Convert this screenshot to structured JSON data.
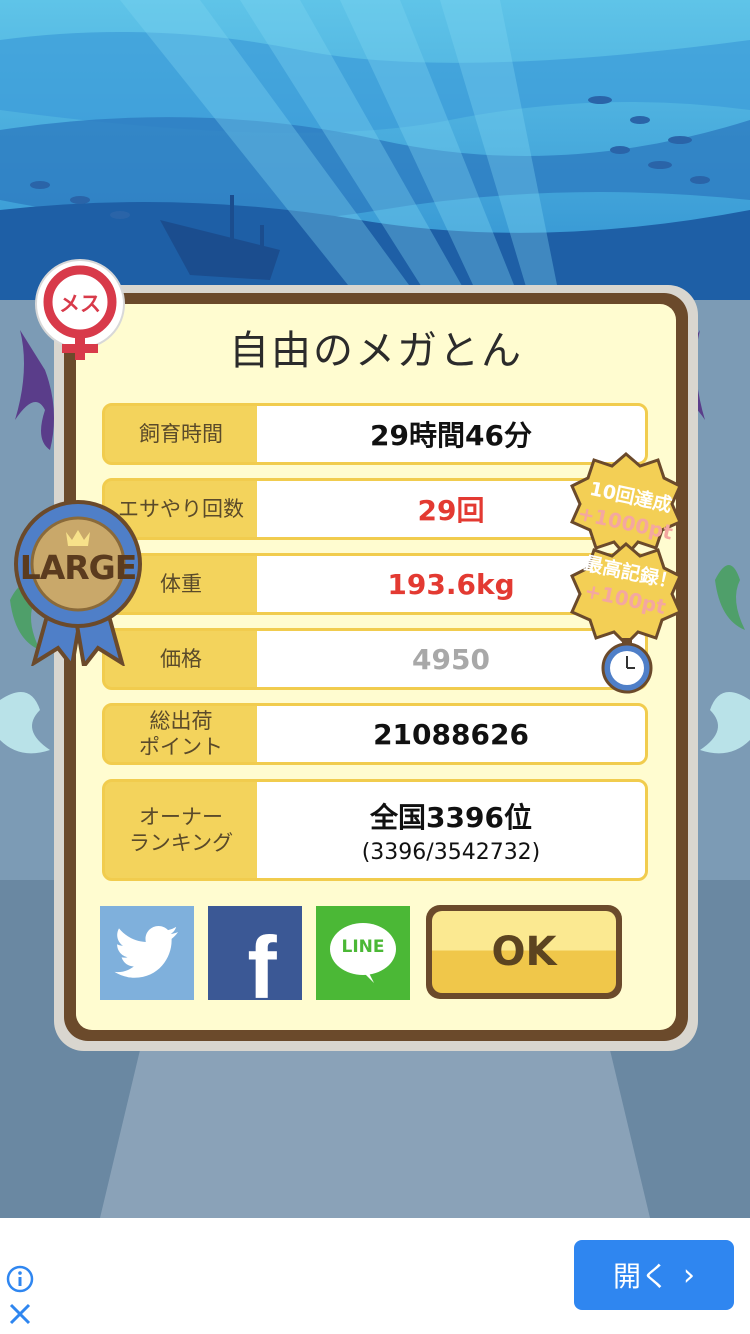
{
  "dialog": {
    "title": "自由のメガとん",
    "gender_badge": "メス",
    "size_ribbon": "LARGE",
    "rows": [
      {
        "label": "飼育時間",
        "value": "29時間46分",
        "style": "normal"
      },
      {
        "label": "エサやり回数",
        "value": "29回",
        "style": "red"
      },
      {
        "label": "体重",
        "value": "193.6kg",
        "style": "red"
      },
      {
        "label": "価格",
        "value": "4950",
        "style": "gray"
      },
      {
        "label": "総出荷\nポイント",
        "value": "21088626",
        "style": "normal"
      },
      {
        "label": "オーナー\nランキング",
        "value": "全国3396位",
        "sub": "(3396/3542732)",
        "style": "normal"
      }
    ],
    "badges": {
      "badge1_line1": "10回達成",
      "badge1_line2": "+1000pt",
      "badge2_line1": "最高記録！",
      "badge2_line2": "+100pt"
    },
    "share": {
      "twitter_icon": "twitter-bird-icon",
      "facebook_label": "f",
      "line_label": "LINE"
    },
    "ok_label": "OK"
  },
  "ad": {
    "open_label": "開く",
    "info_icon": "info-icon",
    "close_icon": "close-icon"
  },
  "colors": {
    "panel_border": "#6b4a2b",
    "panel_bg": "#fffcd0",
    "row_label_bg": "#f3d35c",
    "red_value": "#e33a32",
    "twitter": "#7fb0dc",
    "facebook": "#3b5895",
    "line": "#4bb836",
    "ad_button": "#2f86f0"
  }
}
